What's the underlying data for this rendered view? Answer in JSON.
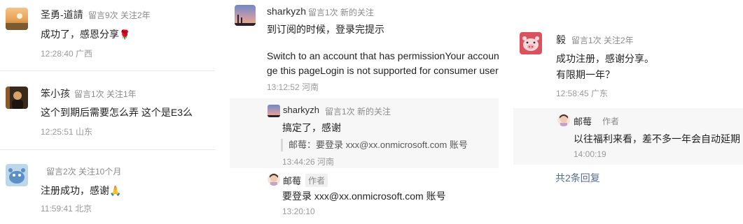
{
  "col1": {
    "c1": {
      "name": "圣勇-道請",
      "meta": "留言9次 关注2年",
      "text": "成功了，感恩分享",
      "emoji": "🌹",
      "time": "12:28:40 广西"
    },
    "c2": {
      "name": "笨小孩",
      "meta": "留言1次 关注1年",
      "text": "这个到期后需要怎么弄 这个是E3么",
      "time": "12:25:51 山东"
    },
    "c3": {
      "name": "",
      "meta": "留言2次 关注10个月",
      "text": "注册成功，感谢",
      "emoji": "🙏",
      "time": "11:59:41 北京"
    }
  },
  "col2": {
    "main": {
      "name": "sharkyzh",
      "meta": "留言1次 新的关注",
      "line1": "到订阅的时候，登录完提示",
      "line2": "Switch to an account that has permissionYour account c",
      "line3": "ge this pageLogin is not supported for consumer users",
      "time": "13:12:52 河南"
    },
    "reply1": {
      "name": "sharkyzh",
      "meta": "留言1次 新的关注",
      "text": "搞定了，感谢",
      "quote": "邮莓：要登录 xxx@xx.onmicrosoft.com 账号",
      "time": "13:44:26 河南"
    },
    "reply2": {
      "name": "邮莓",
      "tag": "作者",
      "text": "要登录 xxx@xx.onmicrosoft.com 账号",
      "time": "13:20:10"
    }
  },
  "col3": {
    "main": {
      "name": "毅",
      "meta": "留言1次 关注2年",
      "line1": "成功注册，感谢分享。",
      "line2": "有限期一年？",
      "time": "12:58:45 广东"
    },
    "reply": {
      "name": "邮莓",
      "tag": "作者",
      "text": "以往福利来看，差不多一年会自动延期",
      "time": "14:00:19"
    },
    "more_link": "共2条回复"
  },
  "colors": {
    "link": "#576b95",
    "reply_bg": "#f7f7f7",
    "divider": "#e8e8e8"
  }
}
